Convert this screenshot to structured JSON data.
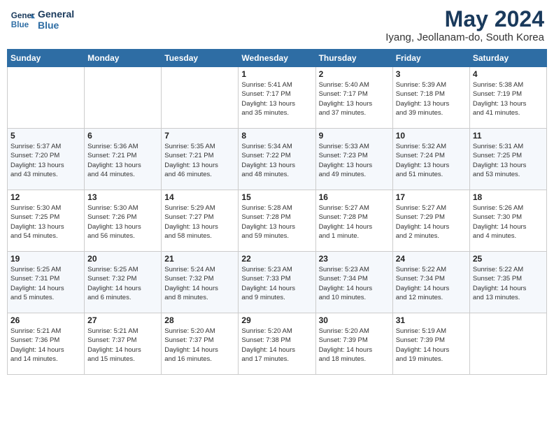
{
  "header": {
    "logo_line1": "General",
    "logo_line2": "Blue",
    "month_title": "May 2024",
    "location": "Iyang, Jeollanam-do, South Korea"
  },
  "days_of_week": [
    "Sunday",
    "Monday",
    "Tuesday",
    "Wednesday",
    "Thursday",
    "Friday",
    "Saturday"
  ],
  "weeks": [
    [
      {
        "day": "",
        "info": ""
      },
      {
        "day": "",
        "info": ""
      },
      {
        "day": "",
        "info": ""
      },
      {
        "day": "1",
        "info": "Sunrise: 5:41 AM\nSunset: 7:17 PM\nDaylight: 13 hours\nand 35 minutes."
      },
      {
        "day": "2",
        "info": "Sunrise: 5:40 AM\nSunset: 7:17 PM\nDaylight: 13 hours\nand 37 minutes."
      },
      {
        "day": "3",
        "info": "Sunrise: 5:39 AM\nSunset: 7:18 PM\nDaylight: 13 hours\nand 39 minutes."
      },
      {
        "day": "4",
        "info": "Sunrise: 5:38 AM\nSunset: 7:19 PM\nDaylight: 13 hours\nand 41 minutes."
      }
    ],
    [
      {
        "day": "5",
        "info": "Sunrise: 5:37 AM\nSunset: 7:20 PM\nDaylight: 13 hours\nand 43 minutes."
      },
      {
        "day": "6",
        "info": "Sunrise: 5:36 AM\nSunset: 7:21 PM\nDaylight: 13 hours\nand 44 minutes."
      },
      {
        "day": "7",
        "info": "Sunrise: 5:35 AM\nSunset: 7:21 PM\nDaylight: 13 hours\nand 46 minutes."
      },
      {
        "day": "8",
        "info": "Sunrise: 5:34 AM\nSunset: 7:22 PM\nDaylight: 13 hours\nand 48 minutes."
      },
      {
        "day": "9",
        "info": "Sunrise: 5:33 AM\nSunset: 7:23 PM\nDaylight: 13 hours\nand 49 minutes."
      },
      {
        "day": "10",
        "info": "Sunrise: 5:32 AM\nSunset: 7:24 PM\nDaylight: 13 hours\nand 51 minutes."
      },
      {
        "day": "11",
        "info": "Sunrise: 5:31 AM\nSunset: 7:25 PM\nDaylight: 13 hours\nand 53 minutes."
      }
    ],
    [
      {
        "day": "12",
        "info": "Sunrise: 5:30 AM\nSunset: 7:25 PM\nDaylight: 13 hours\nand 54 minutes."
      },
      {
        "day": "13",
        "info": "Sunrise: 5:30 AM\nSunset: 7:26 PM\nDaylight: 13 hours\nand 56 minutes."
      },
      {
        "day": "14",
        "info": "Sunrise: 5:29 AM\nSunset: 7:27 PM\nDaylight: 13 hours\nand 58 minutes."
      },
      {
        "day": "15",
        "info": "Sunrise: 5:28 AM\nSunset: 7:28 PM\nDaylight: 13 hours\nand 59 minutes."
      },
      {
        "day": "16",
        "info": "Sunrise: 5:27 AM\nSunset: 7:28 PM\nDaylight: 14 hours\nand 1 minute."
      },
      {
        "day": "17",
        "info": "Sunrise: 5:27 AM\nSunset: 7:29 PM\nDaylight: 14 hours\nand 2 minutes."
      },
      {
        "day": "18",
        "info": "Sunrise: 5:26 AM\nSunset: 7:30 PM\nDaylight: 14 hours\nand 4 minutes."
      }
    ],
    [
      {
        "day": "19",
        "info": "Sunrise: 5:25 AM\nSunset: 7:31 PM\nDaylight: 14 hours\nand 5 minutes."
      },
      {
        "day": "20",
        "info": "Sunrise: 5:25 AM\nSunset: 7:32 PM\nDaylight: 14 hours\nand 6 minutes."
      },
      {
        "day": "21",
        "info": "Sunrise: 5:24 AM\nSunset: 7:32 PM\nDaylight: 14 hours\nand 8 minutes."
      },
      {
        "day": "22",
        "info": "Sunrise: 5:23 AM\nSunset: 7:33 PM\nDaylight: 14 hours\nand 9 minutes."
      },
      {
        "day": "23",
        "info": "Sunrise: 5:23 AM\nSunset: 7:34 PM\nDaylight: 14 hours\nand 10 minutes."
      },
      {
        "day": "24",
        "info": "Sunrise: 5:22 AM\nSunset: 7:34 PM\nDaylight: 14 hours\nand 12 minutes."
      },
      {
        "day": "25",
        "info": "Sunrise: 5:22 AM\nSunset: 7:35 PM\nDaylight: 14 hours\nand 13 minutes."
      }
    ],
    [
      {
        "day": "26",
        "info": "Sunrise: 5:21 AM\nSunset: 7:36 PM\nDaylight: 14 hours\nand 14 minutes."
      },
      {
        "day": "27",
        "info": "Sunrise: 5:21 AM\nSunset: 7:37 PM\nDaylight: 14 hours\nand 15 minutes."
      },
      {
        "day": "28",
        "info": "Sunrise: 5:20 AM\nSunset: 7:37 PM\nDaylight: 14 hours\nand 16 minutes."
      },
      {
        "day": "29",
        "info": "Sunrise: 5:20 AM\nSunset: 7:38 PM\nDaylight: 14 hours\nand 17 minutes."
      },
      {
        "day": "30",
        "info": "Sunrise: 5:20 AM\nSunset: 7:39 PM\nDaylight: 14 hours\nand 18 minutes."
      },
      {
        "day": "31",
        "info": "Sunrise: 5:19 AM\nSunset: 7:39 PM\nDaylight: 14 hours\nand 19 minutes."
      },
      {
        "day": "",
        "info": ""
      }
    ]
  ]
}
